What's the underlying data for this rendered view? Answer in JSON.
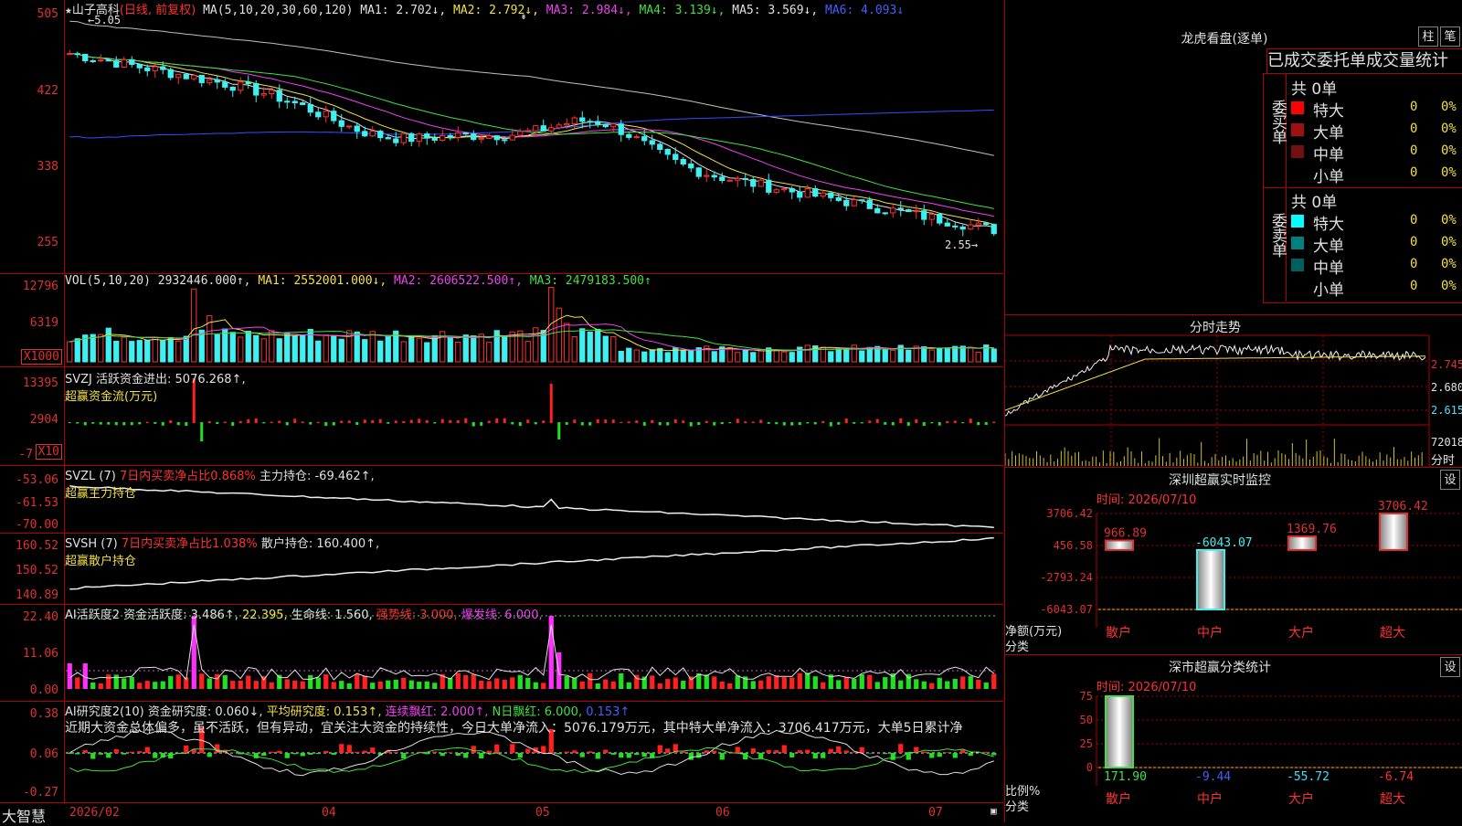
{
  "stock": {
    "name": "山子高科",
    "mode": "(日线, 前复权)",
    "ma_legend": [
      {
        "label": "MA(5,10,20,30,60,120)",
        "color": "#e0e0e0"
      },
      {
        "label": "MA1: 2.702↓,",
        "color": "#e0e0e0"
      },
      {
        "label": "MA2: 2.792↓,",
        "color": "#f0e040"
      },
      {
        "label": "MA3: 2.984↓,",
        "color": "#f040f0"
      },
      {
        "label": "MA4: 3.139↓,",
        "color": "#40e040"
      },
      {
        "label": "MA5: 3.569↓,",
        "color": "#e0e0e0"
      },
      {
        "label": "MA6: 4.093↓",
        "color": "#4060ff"
      }
    ],
    "high_mark": "5.05",
    "low_mark": "2.55",
    "price_axis": [
      "505",
      "422",
      "338",
      "255"
    ]
  },
  "vol": {
    "legend": [
      {
        "label": "VOL(5,10,20)",
        "color": "#e0e0e0"
      },
      {
        "label": "2932446.000↑,",
        "color": "#e0e0e0"
      },
      {
        "label": "MA1: 2552001.000↓,",
        "color": "#f0e040"
      },
      {
        "label": "MA2: 2606522.500↑,",
        "color": "#f040f0"
      },
      {
        "label": "MA3: 2479183.500↑",
        "color": "#40e040"
      }
    ],
    "axis": [
      "12796",
      "6319"
    ],
    "unit": "X1000"
  },
  "svzj": {
    "line1": "SVZJ  活跃资金进出: 5076.268↑,",
    "line2": "超赢资金流(万元)",
    "axis": [
      "13395",
      "2904",
      "-7"
    ],
    "unit": "X10"
  },
  "svzl": {
    "line1a": "SVZL (7)",
    "line1b": "7日内买卖净占比0.868%",
    "line1c": "主力持仓: -69.462↑,",
    "line2": "超赢主力持仓",
    "axis": [
      "-53.06",
      "-61.53",
      "-70.00"
    ]
  },
  "svsh": {
    "line1a": "SVSH (7)",
    "line1b": "7日内买卖净占比1.038%",
    "line1c": "散户持仓: 160.400↑,",
    "line2": "超赢散户持仓",
    "axis": [
      "160.52",
      "150.52",
      "140.89"
    ]
  },
  "ai1": {
    "parts": [
      {
        "label": "AI活跃度2 资金活跃度: 3.486↑,",
        "color": "#e0e0e0"
      },
      {
        "label": "22.395,",
        "color": "#f0e040"
      },
      {
        "label": "生命线: 1.560,",
        "color": "#e0e0e0"
      },
      {
        "label": "强势线: 3.000,",
        "color": "#ff3030"
      },
      {
        "label": "爆发线: 6.000,",
        "color": "#f040f0"
      }
    ],
    "axis": [
      "22.40",
      "11.06",
      "0.00"
    ]
  },
  "ai2": {
    "parts": [
      {
        "label": "AI研究度2(10) 资金研究度: 0.060↓,",
        "color": "#e0e0e0"
      },
      {
        "label": "平均研究度: 0.153↑,",
        "color": "#f0e040"
      },
      {
        "label": "连续飘红: 2.000↑,",
        "color": "#f040f0"
      },
      {
        "label": "N日飘红: 6.000,",
        "color": "#40e040"
      },
      {
        "label": "0.153↑",
        "color": "#4060ff"
      }
    ],
    "comment": "近期大资金总体偏多，虽不活跃，但有异动，宜关注大资金的持续性，今日大单净流入：5076.179万元，其中特大单净流入：3706.417万元，大单5日累计净",
    "axis": [
      "0.38",
      "0.06",
      "-0.27"
    ]
  },
  "xaxis": {
    "brand": "大智慧",
    "labels": [
      "2026/02",
      "04",
      "05",
      "06",
      "07"
    ]
  },
  "dragon": {
    "title": "龙虎看盘(逐单)",
    "btn1": "柱",
    "btn2": "笔",
    "tab_header": "已成交委托单成交量统计",
    "buy_side": "委买单",
    "sell_side": "委卖单",
    "total": "共 0单",
    "rows": [
      {
        "label": "特大",
        "count": "0",
        "pct": "0%"
      },
      {
        "label": "大单",
        "count": "0",
        "pct": "0%"
      },
      {
        "label": "中单",
        "count": "0",
        "pct": "0%"
      },
      {
        "label": "小单",
        "count": "0",
        "pct": "0%"
      }
    ],
    "buy_colors": [
      "#ff0000",
      "#a01010",
      "#701010",
      ""
    ],
    "sell_colors": [
      "#00ffff",
      "#008080",
      "#006060",
      ""
    ]
  },
  "intraday": {
    "title": "分时走势",
    "axis": [
      "2.745",
      "2.680",
      "2.615"
    ],
    "vol_label": "72018",
    "vol_unit": "分时"
  },
  "sz_monitor": {
    "title": "深圳超赢实时监控",
    "btn": "设",
    "time": "时间: 2026/07/10",
    "axis": [
      "3706.42",
      "456.58",
      "-2793.24",
      "-6043.07"
    ],
    "ylabel": "净额(万元)",
    "xlabel": "分类",
    "bars": [
      {
        "cat": "散户",
        "value": 966.89,
        "label": "966.89"
      },
      {
        "cat": "中户",
        "value": -6043.07,
        "label": "-6043.07"
      },
      {
        "cat": "大户",
        "value": 1369.76,
        "label": "1369.76"
      },
      {
        "cat": "超大",
        "value": 3706.42,
        "label": "3706.42"
      }
    ]
  },
  "sz_class": {
    "title": "深市超赢分类统计",
    "btn": "设",
    "time": "时间: 2026/07/10",
    "axis": [
      "75",
      "50",
      "25",
      "0"
    ],
    "ylabel": "比例%",
    "xlabel": "分类",
    "bars": [
      {
        "cat": "散户",
        "value": 171.9,
        "label": "171.90"
      },
      {
        "cat": "中户",
        "value": -9.44,
        "label": "-9.44"
      },
      {
        "cat": "大户",
        "value": -55.72,
        "label": "-55.72"
      },
      {
        "cat": "超大",
        "value": -6.74,
        "label": "-6.74"
      }
    ]
  },
  "chart_data": [
    {
      "type": "bar",
      "title": "深圳超赢实时监控",
      "categories": [
        "散户",
        "中户",
        "大户",
        "超大"
      ],
      "values": [
        966.89,
        -6043.07,
        1369.76,
        3706.42
      ],
      "ylabel": "净额(万元)",
      "xlabel": "分类",
      "ylim": [
        -6043.07,
        3706.42
      ]
    },
    {
      "type": "bar",
      "title": "深市超赢分类统计",
      "categories": [
        "散户",
        "中户",
        "大户",
        "超大"
      ],
      "values": [
        171.9,
        -9.44,
        -55.72,
        -6.74
      ],
      "ylabel": "比例%",
      "xlabel": "分类",
      "ylim": [
        0,
        75
      ]
    }
  ]
}
